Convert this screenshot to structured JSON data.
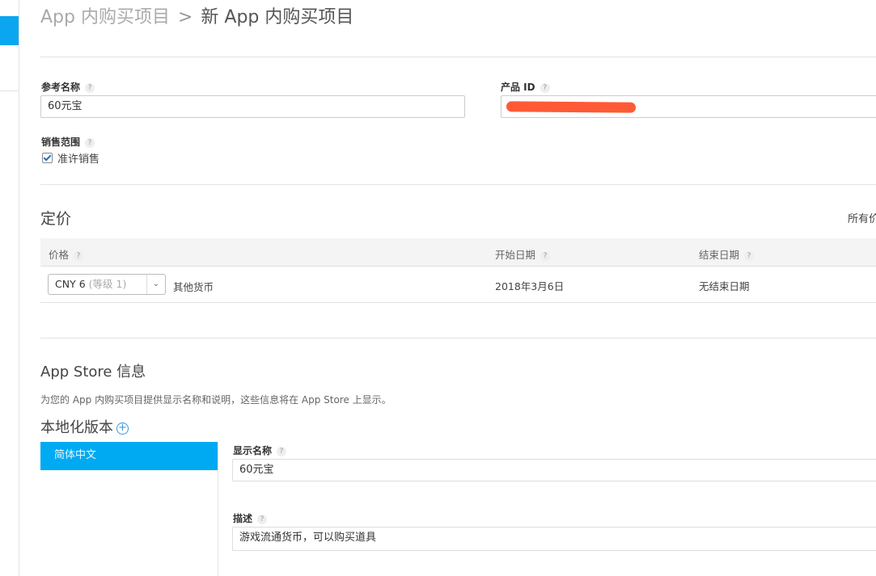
{
  "breadcrumb": {
    "parent": "App 内购买项目",
    "separator": ">",
    "current": "新 App 内购买项目"
  },
  "form": {
    "reference_name": {
      "label": "参考名称",
      "value": "60元宝"
    },
    "product_id": {
      "label": "产品 ID",
      "value": ""
    },
    "sale_range": {
      "label": "销售范围",
      "checkbox_label": "准许销售",
      "checked": true
    },
    "help_glyph": "?"
  },
  "pricing": {
    "title": "定价",
    "all_prices_link": "所有价",
    "headers": {
      "price": "价格",
      "start_date": "开始日期",
      "end_date": "结束日期"
    },
    "row": {
      "price_value": "CNY 6",
      "price_tier": "(等级 1)",
      "other_currency_link": "其他货币",
      "start_date": "2018年3月6日",
      "end_date": "无结束日期"
    }
  },
  "appstore": {
    "title": "App Store 信息",
    "description": "为您的 App 内购买项目提供显示名称和说明，这些信息将在 App Store 上显示。",
    "localization_title": "本地化版本",
    "localizations": [
      "简体中文"
    ],
    "display_name": {
      "label": "显示名称",
      "value": "60元宝"
    },
    "desc_field": {
      "label": "描述",
      "value": "游戏流通货币，可以购买道具"
    }
  },
  "colors": {
    "accent": "#00aaf2",
    "link": "#3b95d6",
    "redaction": "#ff5a36"
  }
}
